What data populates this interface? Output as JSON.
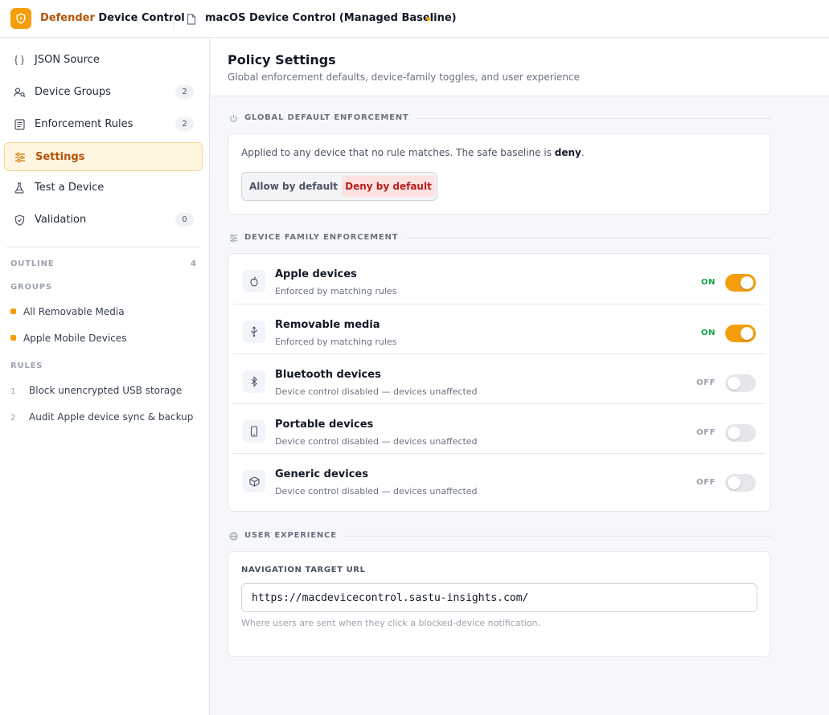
{
  "app": {
    "brand_accent": "Defender",
    "brand_rest": " Device Control",
    "policy_title": "macOS Device Control (Managed Baseline)"
  },
  "sidebar": {
    "nav": [
      {
        "label": "JSON Source",
        "icon": "braces-icon"
      },
      {
        "label": "Device Groups",
        "icon": "users-search-icon",
        "count": "2"
      },
      {
        "label": "Enforcement Rules",
        "icon": "list-doc-icon",
        "count": "2"
      },
      {
        "label": "Settings",
        "icon": "sliders-icon",
        "active": true
      },
      {
        "label": "Test a Device",
        "icon": "flask-icon"
      },
      {
        "label": "Validation",
        "icon": "shield-check-icon",
        "count": "0"
      }
    ],
    "outline_label": "OUTLINE",
    "outline_count": "4",
    "groups_label": "GROUPS",
    "groups": [
      "All Removable Media",
      "Apple Mobile Devices"
    ],
    "rules_label": "RULES",
    "rules": [
      {
        "num": "1",
        "label": "Block unencrypted USB storage"
      },
      {
        "num": "2",
        "label": "Audit Apple device sync & backup"
      }
    ]
  },
  "main": {
    "title": "Policy Settings",
    "subtitle": "Global enforcement defaults, device-family toggles, and user experience"
  },
  "global": {
    "section_title": "GLOBAL DEFAULT ENFORCEMENT",
    "desc_prefix": "Applied to any device that no rule matches. The safe baseline is ",
    "desc_bold": "deny",
    "desc_suffix": ".",
    "allow_label": "Allow by default",
    "deny_label": "Deny by default",
    "selected": "deny"
  },
  "families": {
    "section_title": "DEVICE FAMILY ENFORCEMENT",
    "items": [
      {
        "name": "Apple devices",
        "desc": "Enforced by matching rules",
        "state": "ON",
        "icon": "apple-icon"
      },
      {
        "name": "Removable media",
        "desc": "Enforced by matching rules",
        "state": "ON",
        "icon": "usb-icon"
      },
      {
        "name": "Bluetooth devices",
        "desc": "Device control disabled — devices unaffected",
        "state": "OFF",
        "icon": "bluetooth-icon"
      },
      {
        "name": "Portable devices",
        "desc": "Device control disabled — devices unaffected",
        "state": "OFF",
        "icon": "phone-icon"
      },
      {
        "name": "Generic devices",
        "desc": "Device control disabled — devices unaffected",
        "state": "OFF",
        "icon": "box-icon"
      }
    ]
  },
  "ux": {
    "section_title": "USER EXPERIENCE",
    "url_label": "NAVIGATION TARGET URL",
    "url_value": "https://macdevicecontrol.sastu-insights.com/",
    "url_help": "Where users are sent when they click a blocked-device notification."
  },
  "colors": {
    "accent": "#f59e0b",
    "accent_text": "#b45309",
    "on": "#16a34a",
    "deny": "#b91c1c"
  }
}
